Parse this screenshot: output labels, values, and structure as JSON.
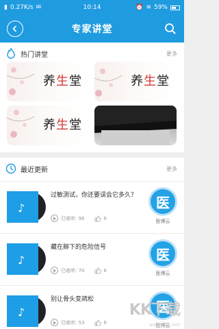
{
  "status_bar": {
    "net_speed": "0.27K/s",
    "time": "10:14",
    "battery": "59%"
  },
  "header": {
    "title": "专家讲堂"
  },
  "hot": {
    "title": "热门讲堂",
    "more": "更多",
    "tiles": [
      {
        "caption": "养生堂"
      },
      {
        "caption": "养生堂"
      },
      {
        "caption": "养生堂"
      },
      {
        "caption": ""
      }
    ]
  },
  "recent": {
    "title": "最近更新",
    "more": "更多",
    "items": [
      {
        "title": "过敏测试，你还要误会它多久？",
        "views": "已收听: 96",
        "likes": "6",
        "badge": "医",
        "badge_sub": "医博云"
      },
      {
        "title": "藏在脚下的危险信号",
        "views": "已收听: 70",
        "likes": "6",
        "badge": "医",
        "badge_sub": "医博云"
      },
      {
        "title": "别让骨头变疏松",
        "views": "已收听: 53",
        "likes": "6",
        "badge": "医",
        "badge_sub": "医博云"
      }
    ]
  },
  "watermark": {
    "text": "KK下载",
    "url": "www.kkx.net"
  },
  "colors": {
    "brand": "#1f9be0",
    "badge": "#24a2e6"
  }
}
